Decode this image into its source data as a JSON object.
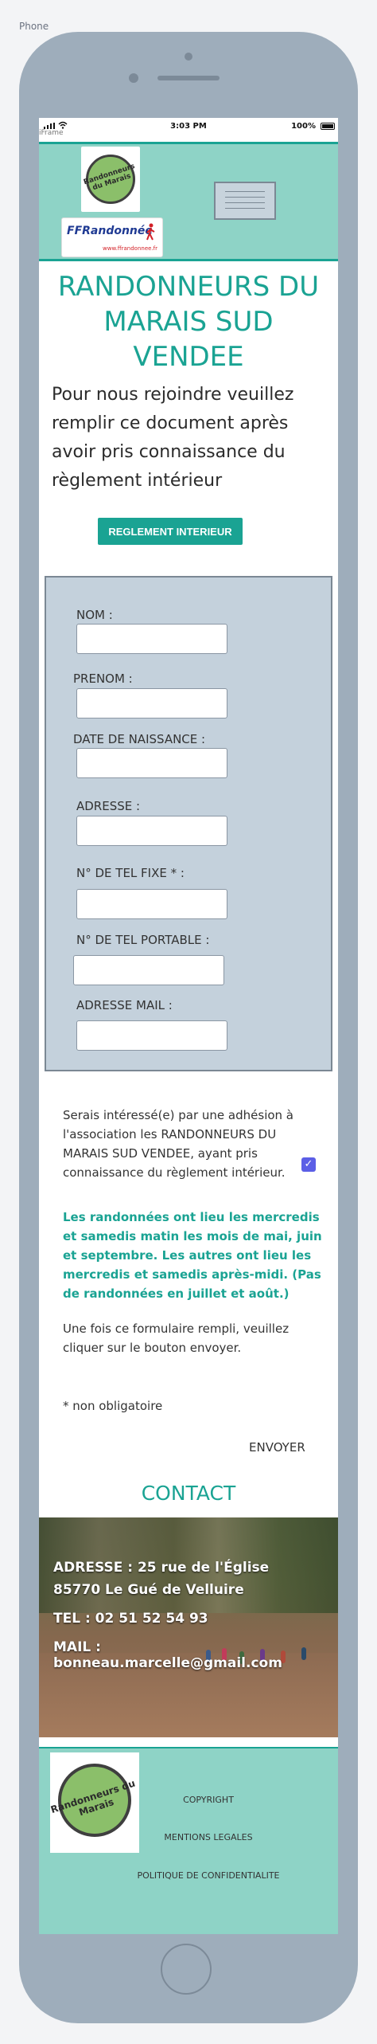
{
  "device_label": "Phone",
  "frame_label": "iFrame",
  "status": {
    "time": "3:03 PM",
    "battery": "100%"
  },
  "header": {
    "logo1_text": "Randonneurs du Marais",
    "logo2_name": "FFRandonnée",
    "logo2_url": "www.ffrandonnee.fr"
  },
  "title": "RANDONNEURS DU MARAIS SUD VENDEE",
  "intro": "Pour nous rejoindre veuillez remplir ce document après avoir pris connaissance du règlement intérieur",
  "reglement_button": "REGLEMENT INTERIEUR",
  "form": {
    "fields": [
      {
        "label": "NOM :",
        "value": ""
      },
      {
        "label": "PRENOM :",
        "value": ""
      },
      {
        "label": "DATE DE NAISSANCE :",
        "value": ""
      },
      {
        "label": "ADRESSE :",
        "value": ""
      },
      {
        "label": "N° DE TEL FIXE * :",
        "value": ""
      },
      {
        "label": "N° DE TEL PORTABLE :",
        "value": ""
      },
      {
        "label": "ADRESSE MAIL :",
        "value": ""
      }
    ]
  },
  "consent": {
    "text": "Serais intéressé(e) par une adhésion à l'association les RANDONNEURS DU MARAIS SUD VENDEE, ayant pris connaissance du règlement intérieur.",
    "checked": true
  },
  "info": "Les randonnées ont lieu les mercredis et samedis matin les mois de mai, juin et septembre. Les autres ont lieu les mercredis et samedis après-midi. (Pas de randonnées en juillet et août.)",
  "instruction": "Une fois ce formulaire rempli, veuillez cliquer sur le bouton envoyer.",
  "note": "* non obligatoire",
  "send_button": "ENVOYER",
  "contact": {
    "heading": "CONTACT",
    "address_line1": "ADRESSE :  25 rue de l'Église",
    "address_line2": "85770 Le Gué de Velluire",
    "tel": "TEL : 02 51 52 54 93",
    "mail": "MAIL : bonneau.marcelle@gmail.com"
  },
  "footer": {
    "logo_text": "Randonneurs du Marais",
    "links": [
      "COPYRIGHT",
      "MENTIONS LEGALES",
      "POLITIQUE DE CONFIDENTIALITE"
    ]
  },
  "colors": {
    "accent": "#1aa393",
    "header_bg": "#8ed3c6",
    "form_bg": "#c4d1dc",
    "phone": "#9eadbb"
  }
}
